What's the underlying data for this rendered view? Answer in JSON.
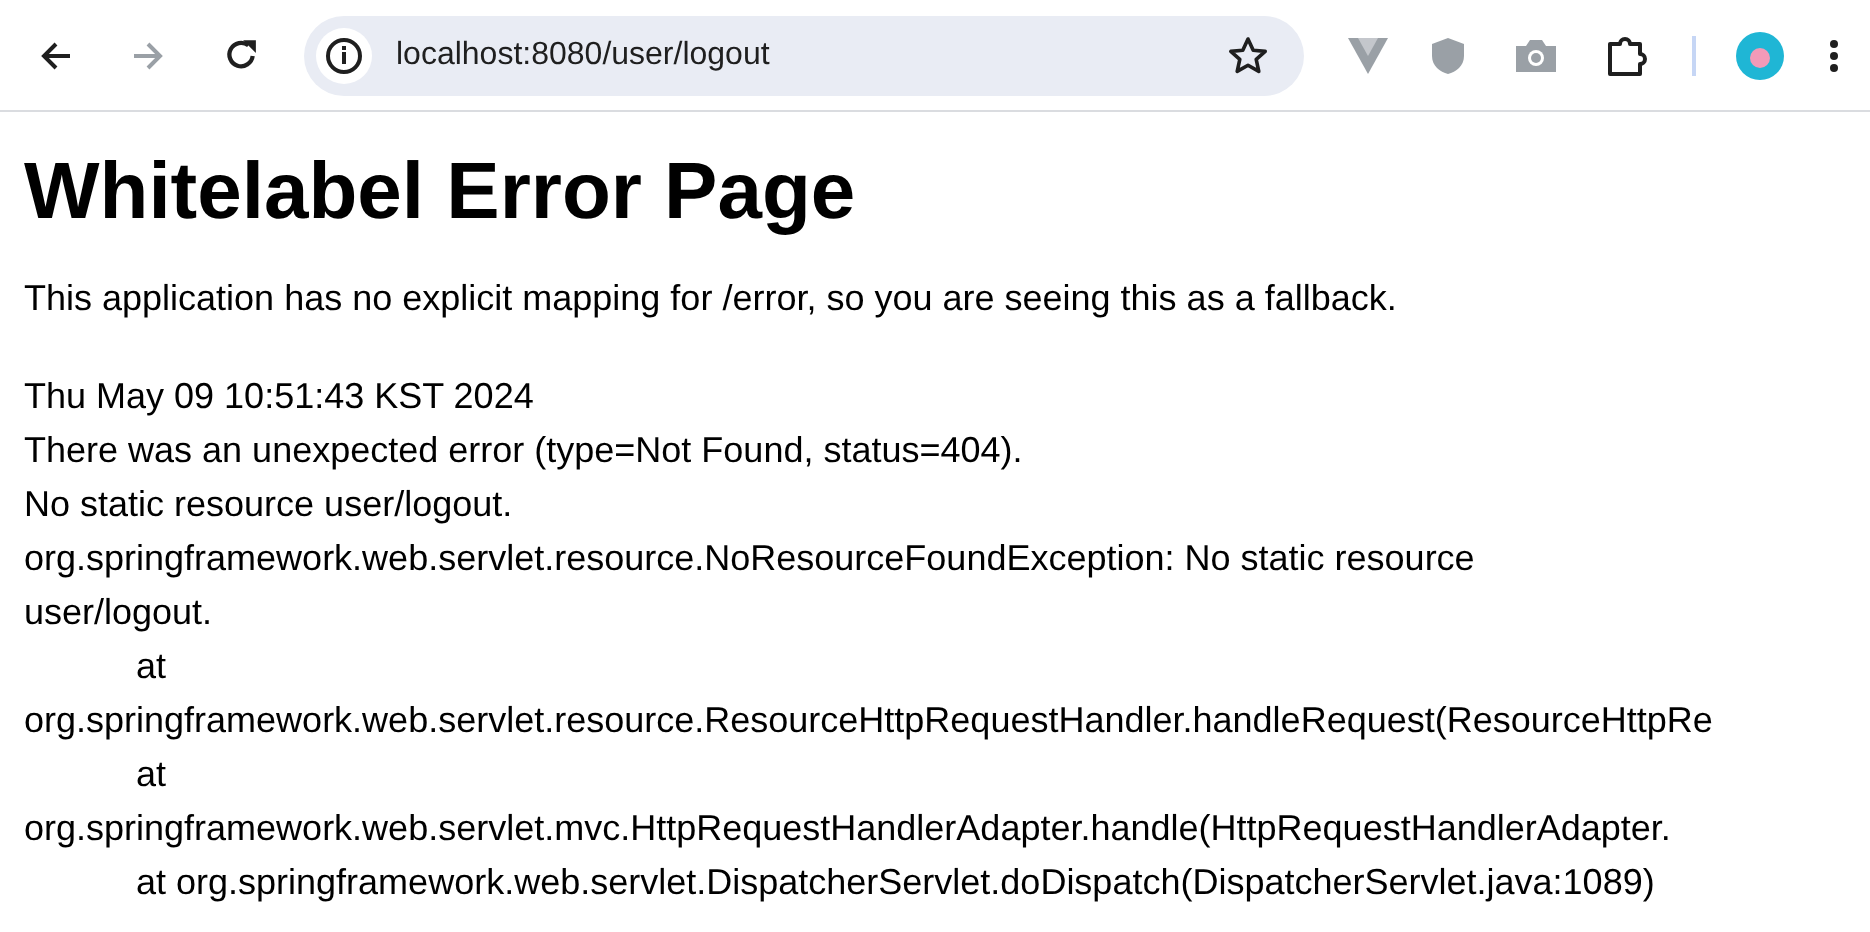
{
  "browser": {
    "url": "localhost:8080/user/logout"
  },
  "page": {
    "title": "Whitelabel Error Page",
    "message": "This application has no explicit mapping for /error, so you are seeing this as a fallback.",
    "lines": [
      {
        "kind": "text",
        "text": "Thu May 09 10:51:43 KST 2024"
      },
      {
        "kind": "text",
        "text": "There was an unexpected error (type=Not Found, status=404)."
      },
      {
        "kind": "text",
        "text": "No static resource user/logout."
      },
      {
        "kind": "wrap",
        "text": "org.springframework.web.servlet.resource.NoResourceFoundException: No static resource user/logout."
      },
      {
        "kind": "frame",
        "text": "at"
      },
      {
        "kind": "text",
        "text": "org.springframework.web.servlet.resource.ResourceHttpRequestHandler.handleRequest(ResourceHttpRe"
      },
      {
        "kind": "frame",
        "text": "at"
      },
      {
        "kind": "text",
        "text": "org.springframework.web.servlet.mvc.HttpRequestHandlerAdapter.handle(HttpRequestHandlerAdapter."
      },
      {
        "kind": "frame",
        "text": "at org.springframework.web.servlet.DispatcherServlet.doDispatch(DispatcherServlet.java:1089)"
      }
    ]
  }
}
